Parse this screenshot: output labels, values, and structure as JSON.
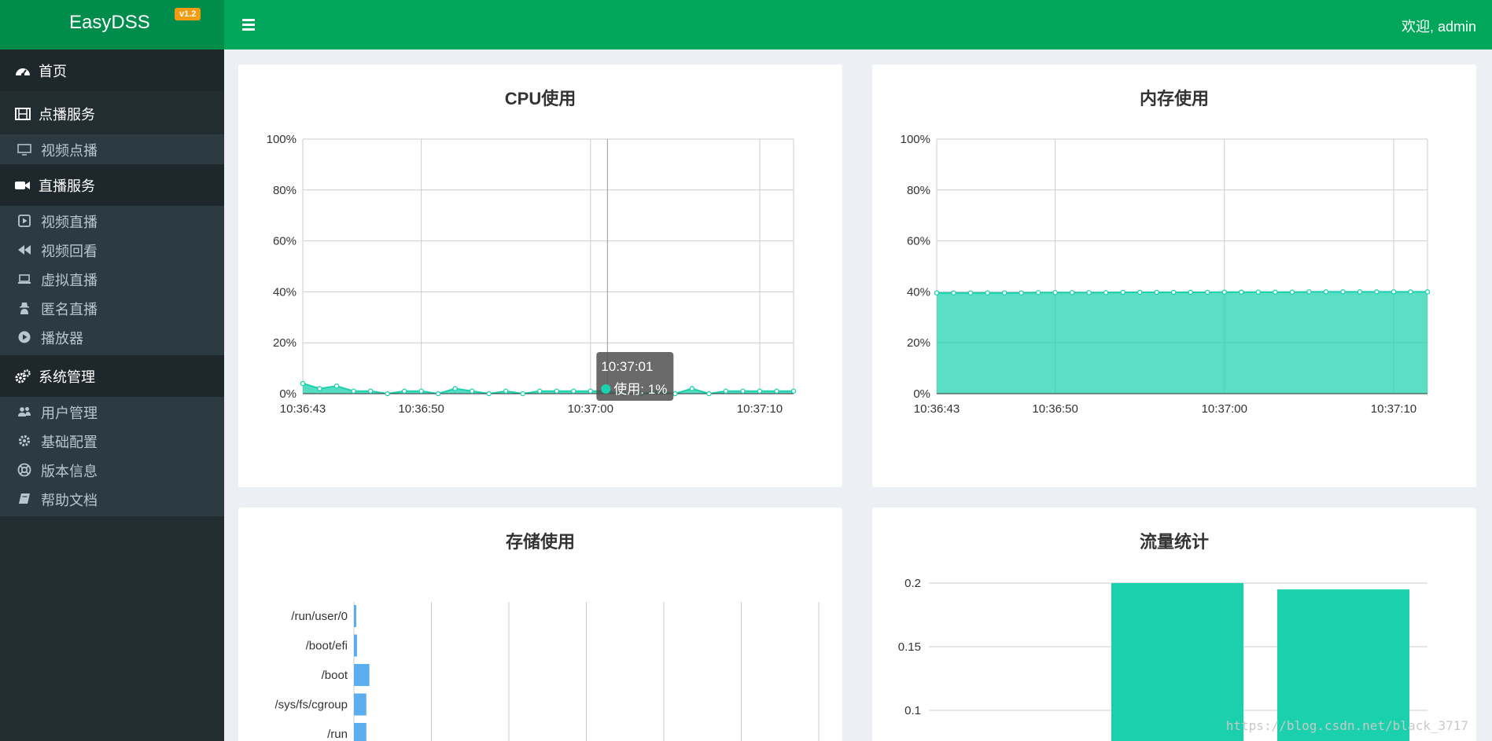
{
  "header": {
    "logo": "EasyDSS",
    "version": "v1.2",
    "welcome": "欢迎, admin"
  },
  "sidebar": {
    "home": "首页",
    "vod_section": "点播服务",
    "vod_items": [
      "视频点播"
    ],
    "live_section": "直播服务",
    "live_items": [
      "视频直播",
      "视频回看",
      "虚拟直播",
      "匿名直播",
      "播放器"
    ],
    "sys_section": "系统管理",
    "sys_items": [
      "用户管理",
      "基础配置",
      "版本信息",
      "帮助文档"
    ]
  },
  "panels": {
    "cpu_title": "CPU使用",
    "mem_title": "内存使用",
    "storage_title": "存储使用",
    "traffic_title": "流量统计"
  },
  "tooltip": {
    "time": "10:37:01",
    "label": "使用: 1%"
  },
  "watermark": "https://blog.csdn.net/black_3717",
  "colors": {
    "header_green": "#00a65a",
    "logo_green": "#008d4c",
    "badge_orange": "#f39c12",
    "series_teal": "#1bd1ad",
    "storage_blue": "#5cadee"
  },
  "chart_data": [
    {
      "type": "area",
      "title": "CPU使用",
      "x_ticks": [
        "10:36:43",
        "10:36:50",
        "10:37:00",
        "10:37:10"
      ],
      "y_ticks": [
        "0%",
        "20%",
        "40%",
        "60%",
        "80%",
        "100%"
      ],
      "ylim": [
        0,
        100
      ],
      "x_range_seconds": [
        0,
        29
      ],
      "series": [
        {
          "values": [
            4,
            2,
            3,
            1,
            1,
            0,
            1,
            1,
            0,
            2,
            1,
            0,
            1,
            0,
            1,
            1,
            1,
            1,
            1,
            0,
            0,
            1,
            0,
            2,
            0,
            1,
            1,
            1,
            1,
            1
          ]
        }
      ]
    },
    {
      "type": "area",
      "title": "内存使用",
      "x_ticks": [
        "10:36:43",
        "10:36:50",
        "10:37:00",
        "10:37:10"
      ],
      "y_ticks": [
        "0%",
        "20%",
        "40%",
        "60%",
        "80%",
        "100%"
      ],
      "ylim": [
        0,
        100
      ],
      "x_range_seconds": [
        0,
        29
      ],
      "series": [
        {
          "values": [
            39.6,
            39.6,
            39.6,
            39.6,
            39.6,
            39.6,
            39.7,
            39.7,
            39.7,
            39.7,
            39.7,
            39.8,
            39.8,
            39.8,
            39.8,
            39.8,
            39.8,
            39.9,
            39.9,
            39.9,
            39.9,
            39.9,
            40,
            40,
            40,
            40,
            40,
            40,
            40,
            40
          ]
        }
      ]
    },
    {
      "type": "bar",
      "title": "存储使用",
      "categories": [
        "/run/user/0",
        "/boot/efi",
        "/boot",
        "/sys/fs/cgroup",
        "/run"
      ],
      "values": [
        0.3,
        0.4,
        2,
        1.6,
        1.6
      ],
      "xlim": [
        0,
        60
      ]
    },
    {
      "type": "bar",
      "title": "流量统计",
      "y_ticks": [
        "0.1",
        "0.15",
        "0.2"
      ],
      "values": [
        0.2,
        0.195
      ]
    }
  ]
}
